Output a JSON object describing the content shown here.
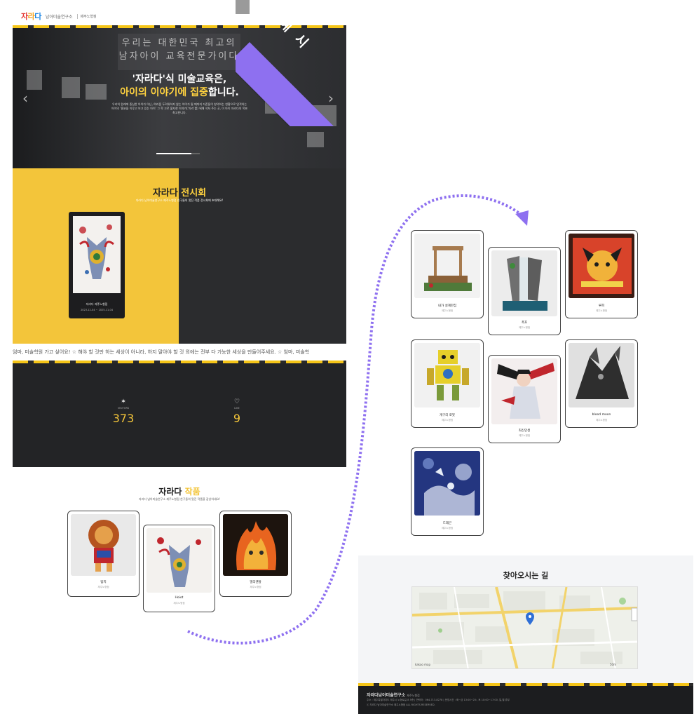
{
  "ribbon": {
    "label": "예 시"
  },
  "header": {
    "logo_chars": [
      "자",
      "라",
      "다"
    ],
    "logo_sub": "남아미술연구소",
    "branch": "제주노형점"
  },
  "hero": {
    "wall_text": "우리는 대한민국 최고의 남자아이 교육전문가이다",
    "title_line1": "'자라다'식 미술교육은,",
    "title_line2_a": "아이의 이야기에 ",
    "title_line2_b": "집중",
    "title_line2_c": "합니다.",
    "desc": "우리의 원래에 중심한 아이가 아닌, 여러움 두려워하지 않는 아이가 될 때까지 자존들이 창의하는 현황으로 엄격하는 아이의 ‘흥분을 이루고 보고 있는 아이’ 그 학 고로 불지한 이야기(‘자리’를) 위해 삭쳐 주는 곳, 이 아이 자라다의 목표 최고한니다.",
    "prev_label": "‹",
    "next_label": "›",
    "progress": 0.8
  },
  "expo": {
    "title_a": "자라다 ",
    "title_b": "전시회",
    "subtitle": "자라다 남아미술연구소 제주노형점 친구들의 멋진 작품 전시회에 초대해요!",
    "card_title": "자라다 제주노형점",
    "card_date": "2023-12-04 ~ 2025-11-04"
  },
  "marquee": {
    "text": "엄마, 미술학원 가고 싶어요! ☆ 해야 할 것만 하는 세상이 아니라, 하지 말아야 할 것 외에는 전부 다 가능한 세상을 만들어주세요. ☆  엄마, 미술학"
  },
  "stats": {
    "visitors_label": "VISITORS",
    "visitors_value": "373",
    "likes_label": "LIKE",
    "likes_value": "9"
  },
  "works": {
    "title_a": "자라다 ",
    "title_b": "작품",
    "subtitle": "자라다 남아미술연구소 제주노형점 친구들의 멋진 작품을 감상하세요!",
    "cards": [
      {
        "title": "탐지",
        "sub": "제주노형점"
      },
      {
        "title": "Hoiot",
        "sub": "제주노형점"
      },
      {
        "title": "엘리멘탈",
        "sub": "제주노형점"
      }
    ]
  },
  "gallery": {
    "cards": [
      {
        "title": "내가 설계한집",
        "sub": "제주노형점"
      },
      {
        "title": "폭포",
        "sub": "제주노형점"
      },
      {
        "title": "루피",
        "sub": "제주노형점"
      },
      {
        "title": "개구리 로봇",
        "sub": "제주노형점"
      },
      {
        "title": "최신인생",
        "sub": "제주노형점"
      },
      {
        "title": "blood moon",
        "sub": "제주노형점"
      },
      {
        "title": "드래곤",
        "sub": "제주노형점"
      }
    ]
  },
  "map_section": {
    "title": "찾아오시는 길",
    "map_brand": "kakao map",
    "map_scale": "50m"
  },
  "footer": {
    "brand": "자라다남아미술연구소",
    "branch": "제주노형점",
    "line1": "주소 : 제주특별자치도 제주시 노형로길 8 5층 | 연락처 : 064-713-8278 | 운영시간 : 화~금 13:00~20:, 토 10:00~17:00, 일,월 휴무",
    "line2": "ⓒ 자라다 남아미술연구소 제주노형점 ALL RIGHTS RESERVED."
  },
  "colors": {
    "accent": "#f3c53a",
    "ribbon": "#8e70f0",
    "dark": "#232426"
  }
}
